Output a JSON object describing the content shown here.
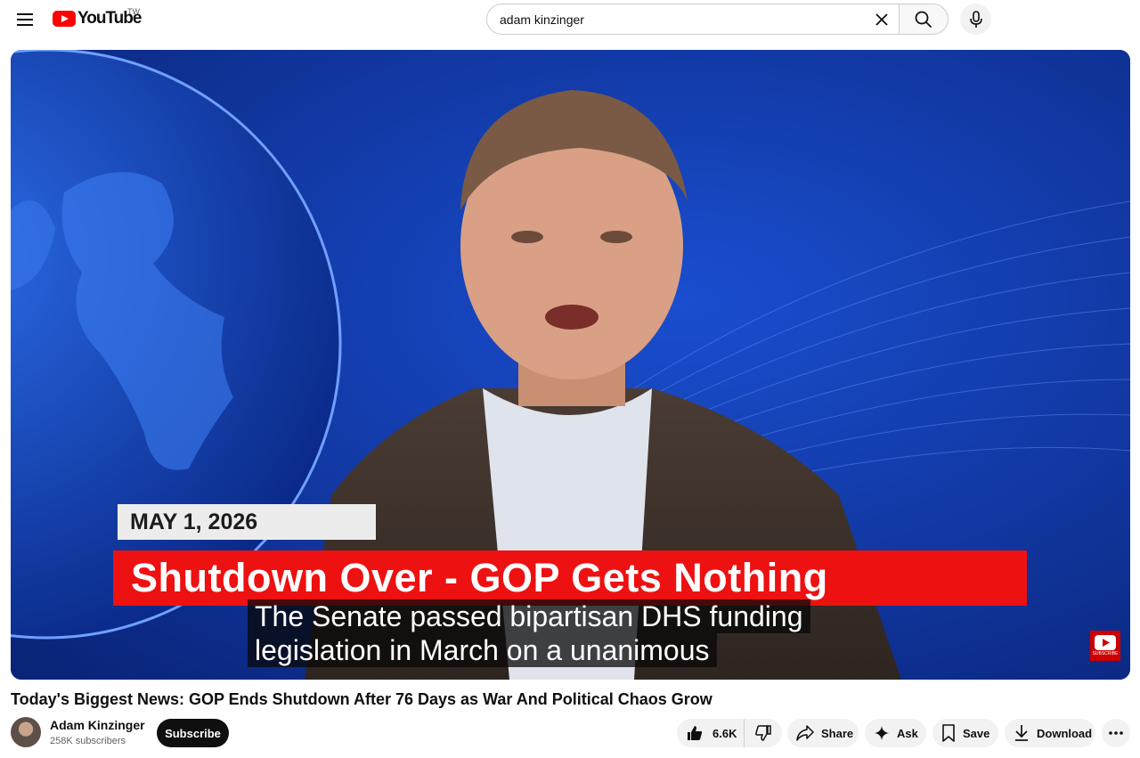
{
  "header": {
    "logo_text": "YouTube",
    "region_code": "TW",
    "search": {
      "value": "adam kinzinger",
      "placeholder": "Search"
    }
  },
  "player": {
    "date_chyron": "MAY 1, 2026",
    "headline_chyron": "Shutdown Over - GOP Gets Nothing",
    "captions": [
      "The Senate passed bipartisan DHS funding",
      "legislation in March on a unanimous"
    ],
    "watermark_text": "SUBSCRIBE"
  },
  "video": {
    "title": "Today's Biggest News: GOP Ends Shutdown After 76 Days as War And Political Chaos Grow",
    "channel_name": "Adam Kinzinger",
    "subscribers": "258K subscribers",
    "subscribe_label": "Subscribe"
  },
  "actions": {
    "like_count": "6.6K",
    "share_label": "Share",
    "ask_label": "Ask",
    "save_label": "Save",
    "download_label": "Download"
  },
  "colors": {
    "brand_red": "#ff0000",
    "chyron_red": "#ee1111",
    "backdrop_blue": "#0a2a8a"
  }
}
